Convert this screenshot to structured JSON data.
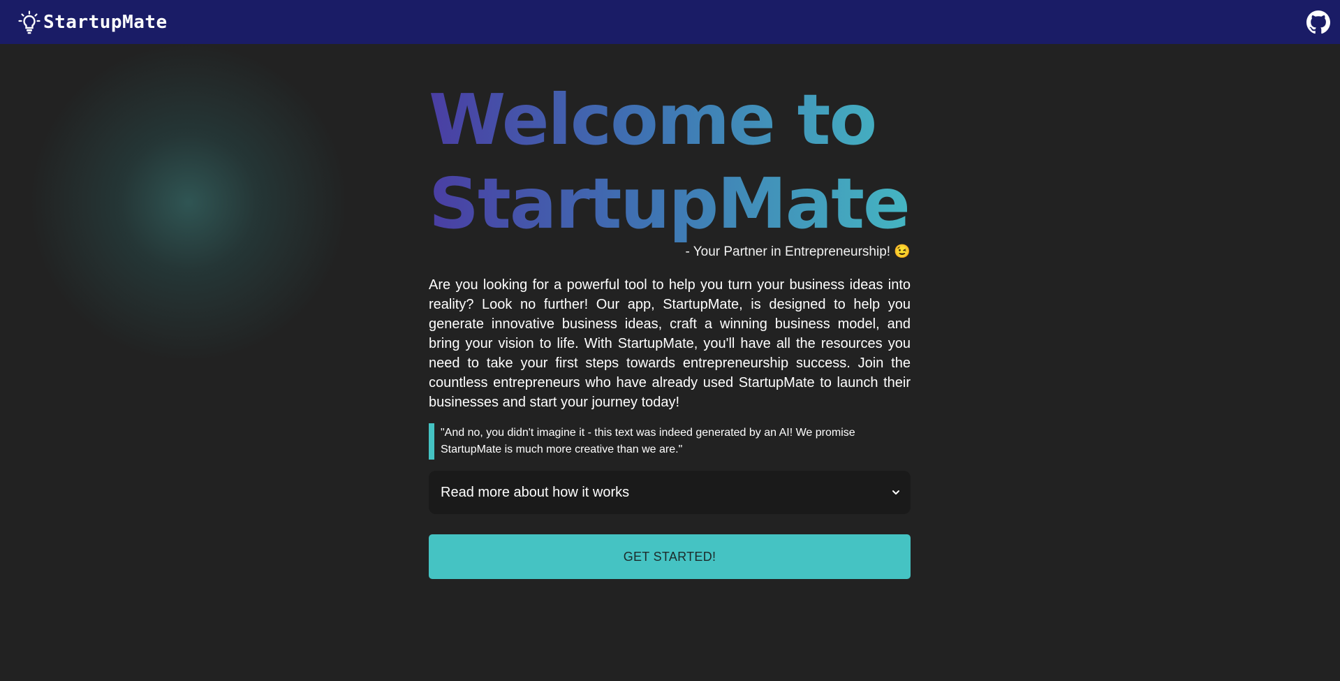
{
  "navbar": {
    "brand_name": "StartupMate",
    "logo_icon": "lightbulb-icon",
    "github_icon": "github-icon"
  },
  "hero": {
    "title_line1": "Welcome to",
    "title_line2": "StartupMate",
    "tagline": "- Your Partner in Entrepreneurship! 😉"
  },
  "description": "Are you looking for a powerful tool to help you turn your business ideas into reality? Look no further! Our app, StartupMate, is designed to help you generate innovative business ideas, craft a winning business model, and bring your vision to life. With StartupMate, you'll have all the resources you need to take your first steps towards entrepreneurship success. Join the countless entrepreneurs who have already used StartupMate to launch their businesses and start your journey today!",
  "quote": "\"And no, you didn't imagine it - this text was indeed generated by an AI! We promise StartupMate is much more creative than we are.\"",
  "accordion": {
    "label": "Read more about how it works",
    "icon": "chevron-down-icon"
  },
  "cta": {
    "label": "GET STARTED!"
  },
  "colors": {
    "navbar": "#1a1c66",
    "background": "#222222",
    "accent": "#45c3c3",
    "gradient_start": "#4a3ea3",
    "gradient_end": "#45b6c2"
  }
}
